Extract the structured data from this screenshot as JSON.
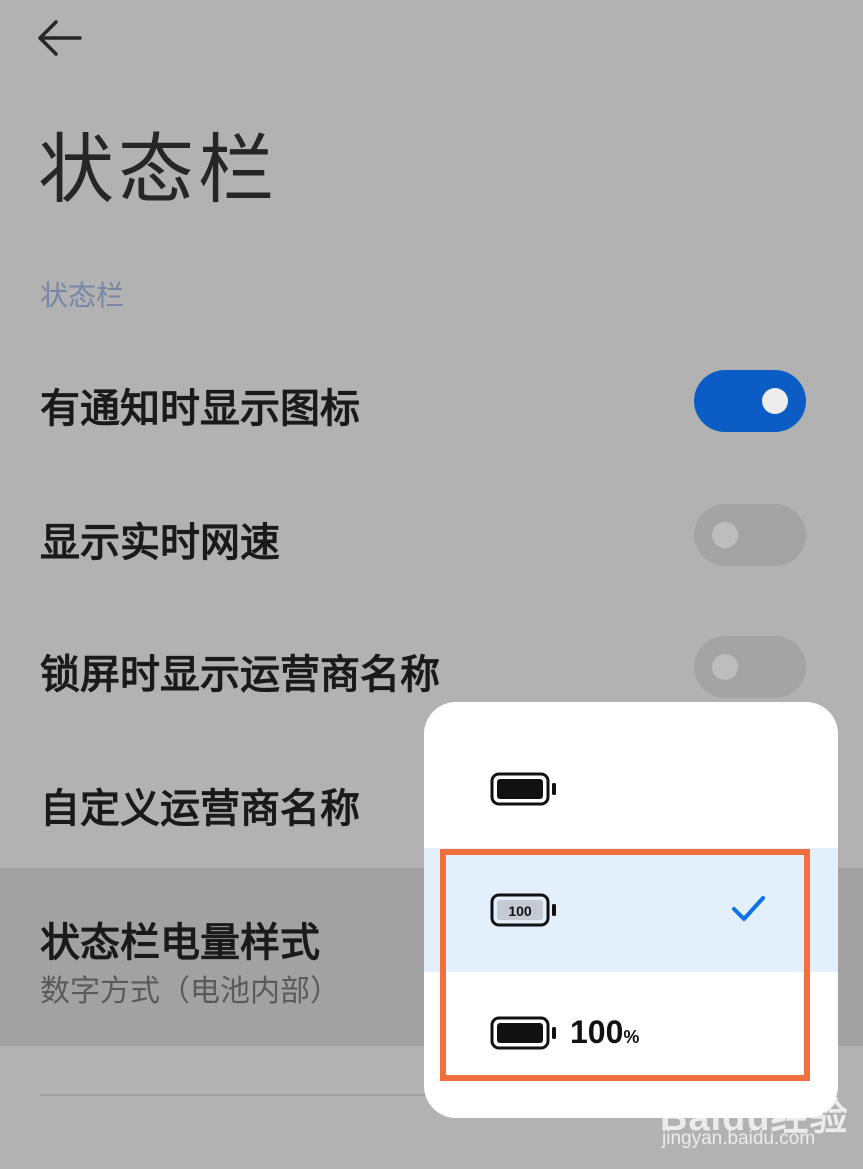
{
  "header": {
    "back_icon": "arrow-left-icon",
    "title": "状态栏"
  },
  "section": {
    "header": "状态栏"
  },
  "settings": [
    {
      "label": "有通知时显示图标",
      "toggle": true
    },
    {
      "label": "显示实时网速",
      "toggle": false
    },
    {
      "label": "锁屏时显示运营商名称",
      "toggle": false
    },
    {
      "label": "自定义运营商名称"
    },
    {
      "label": "状态栏电量样式",
      "value": "数字方式（电池内部）"
    }
  ],
  "popup": {
    "options": [
      {
        "icon": "battery-full-icon",
        "text": "",
        "selected": false
      },
      {
        "icon": "battery-number-inside-icon",
        "inner_text": "100",
        "selected": true
      },
      {
        "icon": "battery-full-icon",
        "text": "100",
        "suffix": "%",
        "selected": false
      }
    ],
    "check_icon": "check-icon"
  },
  "colors": {
    "accent": "#0b5dc5",
    "highlight_border": "#ef6f3f",
    "selected_bg": "#e4effc"
  },
  "watermark": {
    "brand": "Baidu经验",
    "url": "jingyan.baidu.com"
  }
}
